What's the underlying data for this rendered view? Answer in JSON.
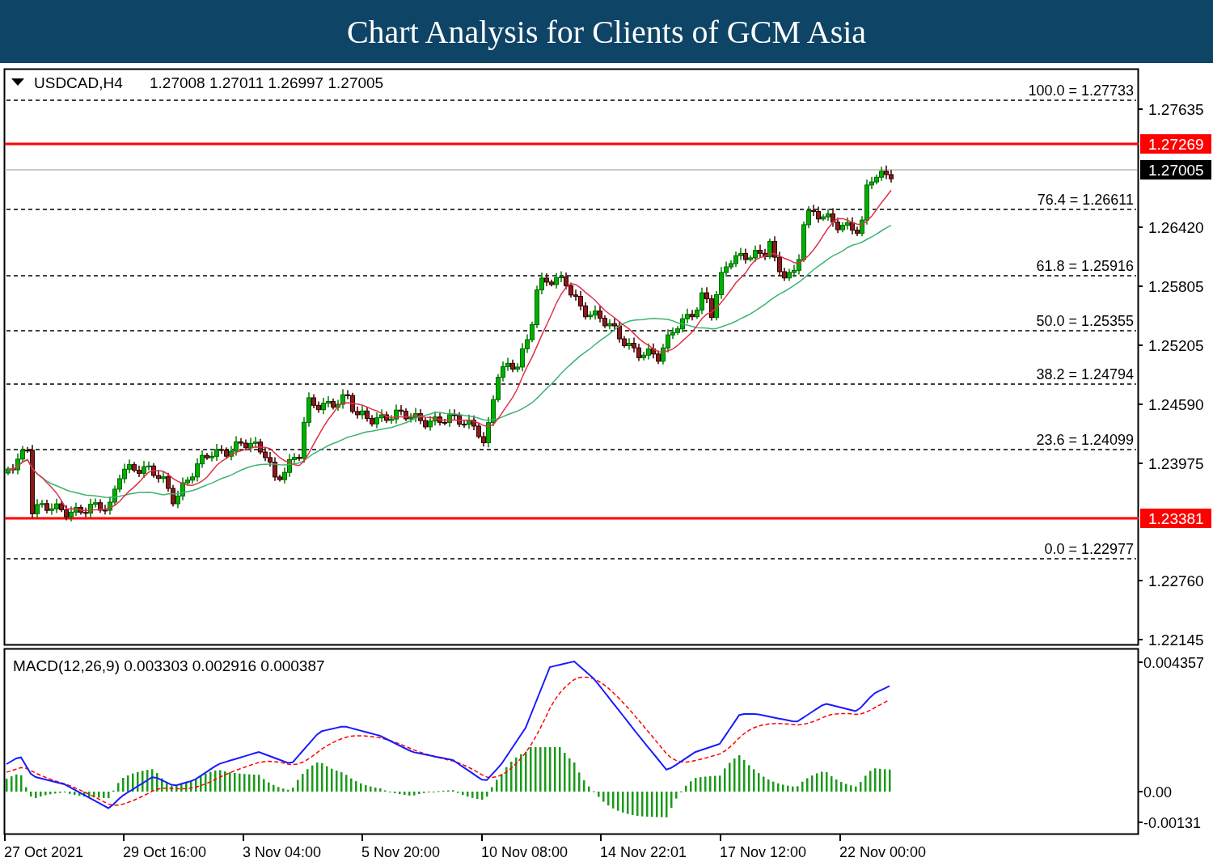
{
  "header": {
    "title": "Chart Analysis for Clients of GCM Asia"
  },
  "main_chart": {
    "symbol": "USDCAD,H4",
    "quote": "1.27008 1.27011 1.26997 1.27005",
    "fib_levels": [
      {
        "label": "100.0 = 1.27733"
      },
      {
        "label": "76.4 = 1.26611"
      },
      {
        "label": "61.8 = 1.25916"
      },
      {
        "label": "50.0 = 1.25355"
      },
      {
        "label": "38.2 = 1.24794"
      },
      {
        "label": "23.6 = 1.24099"
      },
      {
        "label": "0.0 = 1.22977"
      }
    ],
    "price_lines": [
      {
        "kind": "level",
        "value": "1.27269"
      },
      {
        "kind": "bid",
        "value": "1.27005"
      },
      {
        "kind": "level",
        "value": "1.23381"
      }
    ],
    "price_axis": [
      "1.27635",
      "1.26420",
      "1.25805",
      "1.25205",
      "1.24590",
      "1.23975",
      "1.22760",
      "1.22145"
    ]
  },
  "macd": {
    "label": "MACD(12,26,9) 0.003303 0.002916 0.000387",
    "axis": [
      "0.004357",
      "0.00",
      "-0.00131"
    ]
  },
  "time_axis": [
    "27 Oct 2021",
    "29 Oct 16:00",
    "3 Nov 04:00",
    "5 Nov 20:00",
    "10 Nov 08:00",
    "14 Nov 22:01",
    "17 Nov 12:00",
    "22 Nov 00:00"
  ]
}
